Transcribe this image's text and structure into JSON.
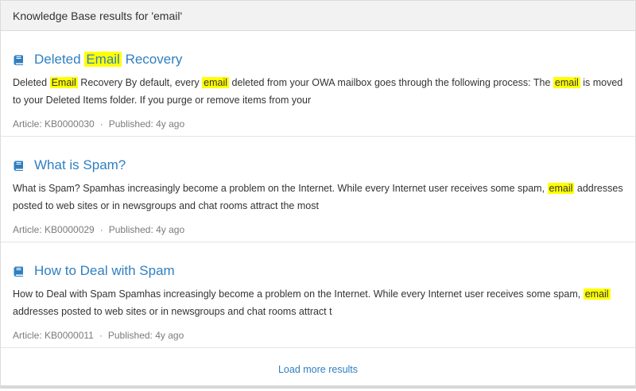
{
  "header": {
    "title": "Knowledge Base results for 'email'"
  },
  "results": [
    {
      "title_parts": [
        "Deleted ",
        "Email",
        " Recovery"
      ],
      "snippet_parts": [
        "Deleted ",
        "Email",
        " Recovery By default, every ",
        "email",
        " deleted from your OWA mailbox goes through the following process: The ",
        "email",
        " is moved to your Deleted Items folder. If you purge or remove items from your"
      ],
      "article": "Article: KB0000030",
      "published": "Published: 4y ago"
    },
    {
      "title_parts": [
        "What is Spam?"
      ],
      "snippet_parts": [
        "What is Spam? Spamhas increasingly become a problem on the Internet. While every Internet user receives some spam, ",
        "email",
        " addresses posted to web sites or in newsgroups and chat rooms attract the most"
      ],
      "article": "Article: KB0000029",
      "published": "Published: 4y ago"
    },
    {
      "title_parts": [
        "How to Deal with Spam"
      ],
      "snippet_parts": [
        "How to Deal with Spam Spamhas increasingly become a problem on the Internet. While every Internet user receives some spam, ",
        "email",
        " addresses posted to web sites or in newsgroups and chat rooms attract t"
      ],
      "article": "Article: KB0000011",
      "published": "Published: 4y ago"
    }
  ],
  "separator": "·",
  "load_more": "Load more results",
  "icons": {
    "result": "book-icon"
  },
  "colors": {
    "link": "#2f7fc1",
    "highlight": "#ffff00",
    "header_bg": "#f2f2f2",
    "meta": "#7b7b7b"
  }
}
